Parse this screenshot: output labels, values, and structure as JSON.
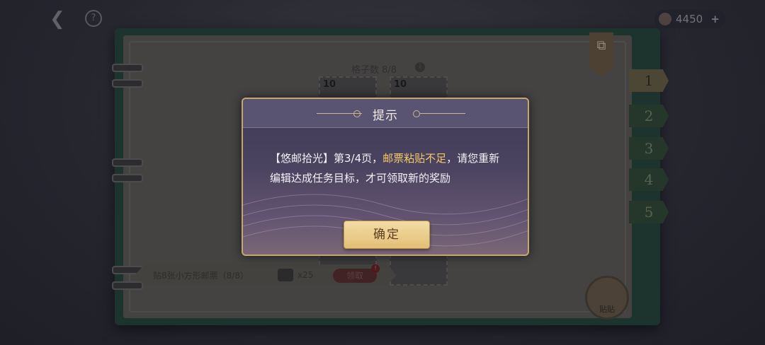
{
  "topbar": {
    "back_icon": "chevron-left-icon",
    "help_label": "?",
    "currency_value": "4450",
    "currency_plus": "+"
  },
  "album": {
    "slots_title": "格子数 8/8",
    "stamps": [
      {
        "value": "10"
      },
      {
        "value": "10"
      }
    ],
    "tabs": [
      "1",
      "2",
      "3",
      "4",
      "5"
    ],
    "footer": {
      "task": "贴8张小方形邮票（8/8）",
      "reward_qty": "x25",
      "claim_label": "领取",
      "claim_badge": "!"
    },
    "paste_label": "贴贴"
  },
  "modal": {
    "title": "提示",
    "body_part1": "【悠邮拾光】第3/4页，",
    "body_highlight": "邮票粘贴不足",
    "body_part2": "，请您重新编辑达成任务目标，才可领取新的奖励",
    "confirm_label": "确定"
  },
  "colors": {
    "accent_gold": "#e3bf76",
    "highlight": "#f5c96a",
    "modal_bg": "#4b4460"
  }
}
